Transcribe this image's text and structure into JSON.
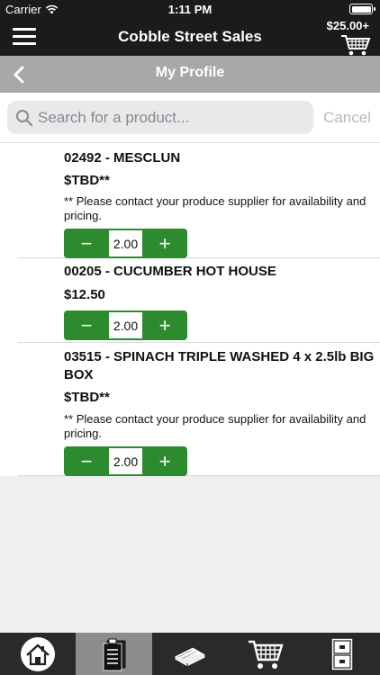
{
  "status_bar": {
    "carrier": "Carrier",
    "time": "1:11 PM"
  },
  "nav": {
    "title": "Cobble Street Sales",
    "cart_total": "$25.00+"
  },
  "sub_header": {
    "title": "My Profile"
  },
  "search": {
    "placeholder": "Search for a product...",
    "value": "",
    "cancel_label": "Cancel"
  },
  "products": [
    {
      "name": "02492 - MESCLUN",
      "price": "$TBD**",
      "note": "** Please contact your produce supplier for availability and pricing.",
      "quantity": "2.00"
    },
    {
      "name": "00205 - CUCUMBER HOT HOUSE",
      "price": "$12.50",
      "quantity": "2.00"
    },
    {
      "name": "03515 - SPINACH TRIPLE WASHED 4 x 2.5lb BIG BOX",
      "price": "$TBD**",
      "note": "** Please contact your produce supplier for availability and pricing.",
      "quantity": "2.00"
    }
  ],
  "stepper": {
    "minus": "−",
    "plus": "+"
  },
  "tab_bar": {
    "tabs": [
      {
        "icon": "home-icon",
        "active": false
      },
      {
        "icon": "order-list-icon",
        "active": true
      },
      {
        "icon": "catalog-icon",
        "active": false
      },
      {
        "icon": "cart-icon",
        "active": false
      },
      {
        "icon": "file-cabinet-icon",
        "active": false
      }
    ]
  },
  "colors": {
    "stepper_green": "#2d8a2f",
    "nav_dark": "#1b1b1b",
    "sub_header_gray": "#a8a8a8",
    "active_tab": "#8c8c8c"
  }
}
